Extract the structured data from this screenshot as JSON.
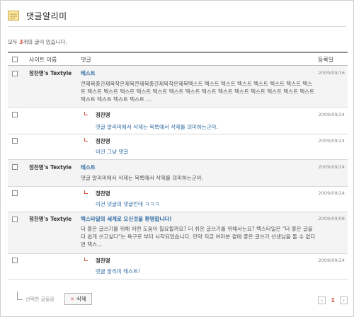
{
  "header": {
    "title": "댓글알리미"
  },
  "summary": {
    "prefix": "모두 ",
    "count": "3",
    "suffix": "개의 글이 있습니다."
  },
  "table": {
    "col_site": "사이트 이름",
    "col_comment": "댓글",
    "col_date": "등록일"
  },
  "posts": [
    {
      "author": "정찬명's Textyle",
      "title": "테스트",
      "date": "2009/09/16",
      "body": "큰제목중간제목작은제목큰제목중간제목작은제목텍스트 텍스트 텍스트 텍스트 텍스트 텍스트 텍스트 텍스트 텍스트 텍스트 텍스트 텍스트 텍스트 텍스트 텍스트 텍스트 텍스트 텍스트 텍스트 텍스트 텍스트 텍스트 텍스트 텍스트 텍스트 텍스트 ...",
      "replies": [
        {
          "author": "정찬명",
          "text": "댓글 알리미에서 삭제는 목록에서 삭제를 의미하는군아.",
          "date": "2009/09/24"
        },
        {
          "author": "정찬명",
          "text": "이건 그냥 댓글",
          "date": "2009/09/24"
        }
      ]
    },
    {
      "author": "정찬명's Textyle",
      "title": "테스트",
      "date": "2009/09/24",
      "body": "댓글 알리미에서 삭제는 목록에서 삭제를 의미하는군아.",
      "replies": [
        {
          "author": "정찬명",
          "text": "이건 댓글의 댓글인데 ㅋㅋㅋ",
          "date": "2009/09/24"
        }
      ]
    },
    {
      "author": "정찬명's Textyle",
      "title": "텍스타일의 세계로 오신것을 환영합니다!",
      "date": "2009/09/08",
      "body": "더 좋은 글쓰기를 위해 어떤 도움이 필요할까요? 더 쉬운 글쓰기를 위해서는요? 텍스타일은 \"더 좋은 글을 더 쉽게 쓰고싶다\"는 욕구로 부터 시작되었습니다. 만약 지금 여러분 곁에 좋은 글쓰기 선생님을 둘 수 없다면 텍스...",
      "replies": [
        {
          "author": "정찬명",
          "text": "댓글 알리미 테스트!",
          "date": "2009/09/24"
        }
      ]
    }
  ],
  "footer": {
    "selected_label": "선택한 글들을",
    "delete_label": "삭제",
    "delete_icon": "x-icon"
  },
  "pager": {
    "prev": "‹",
    "current": "1",
    "next": "›"
  },
  "colors": {
    "accent": "#d4503d",
    "link": "#2e6aa3"
  }
}
